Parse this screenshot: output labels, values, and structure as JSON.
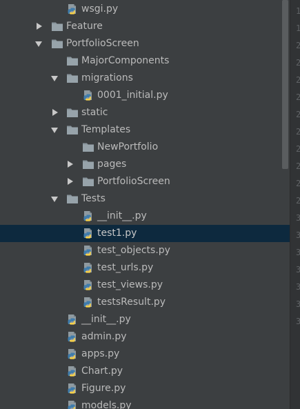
{
  "project_tree": {
    "selected_index": 13,
    "items": [
      {
        "label": "wsgi.py",
        "type": "python",
        "depth": 3,
        "arrow": "none"
      },
      {
        "label": "Feature",
        "type": "folder",
        "depth": 2,
        "arrow": "right"
      },
      {
        "label": "PortfolioScreen",
        "type": "folder",
        "depth": 2,
        "arrow": "down"
      },
      {
        "label": "MajorComponents",
        "type": "folder",
        "depth": 3,
        "arrow": "none"
      },
      {
        "label": "migrations",
        "type": "folder",
        "depth": 3,
        "arrow": "down"
      },
      {
        "label": "0001_initial.py",
        "type": "python",
        "depth": 4,
        "arrow": "none"
      },
      {
        "label": "static",
        "type": "folder",
        "depth": 3,
        "arrow": "right"
      },
      {
        "label": "Templates",
        "type": "folder",
        "depth": 3,
        "arrow": "down"
      },
      {
        "label": "NewPortfolio",
        "type": "folder",
        "depth": 4,
        "arrow": "none"
      },
      {
        "label": "pages",
        "type": "folder",
        "depth": 4,
        "arrow": "right"
      },
      {
        "label": "PortfolioScreen",
        "type": "folder",
        "depth": 4,
        "arrow": "right"
      },
      {
        "label": "Tests",
        "type": "folder",
        "depth": 3,
        "arrow": "down"
      },
      {
        "label": "__init__.py",
        "type": "python",
        "depth": 4,
        "arrow": "none"
      },
      {
        "label": "test1.py",
        "type": "python",
        "depth": 4,
        "arrow": "none"
      },
      {
        "label": "test_objects.py",
        "type": "python",
        "depth": 4,
        "arrow": "none"
      },
      {
        "label": "test_urls.py",
        "type": "python",
        "depth": 4,
        "arrow": "none"
      },
      {
        "label": "test_views.py",
        "type": "python",
        "depth": 4,
        "arrow": "none"
      },
      {
        "label": "testsResult.py",
        "type": "python",
        "depth": 4,
        "arrow": "none"
      },
      {
        "label": "__init__.py",
        "type": "python",
        "depth": 3,
        "arrow": "none"
      },
      {
        "label": "admin.py",
        "type": "python",
        "depth": 3,
        "arrow": "none"
      },
      {
        "label": "apps.py",
        "type": "python",
        "depth": 3,
        "arrow": "none"
      },
      {
        "label": "Chart.py",
        "type": "python",
        "depth": 3,
        "arrow": "none"
      },
      {
        "label": "Figure.py",
        "type": "python",
        "depth": 3,
        "arrow": "none"
      },
      {
        "label": "models.py",
        "type": "python",
        "depth": 3,
        "arrow": "none"
      }
    ]
  },
  "gutter": {
    "line_numbers": [
      "1",
      "1",
      "2",
      "2",
      "2",
      "2",
      "2",
      "2",
      "2",
      "2",
      "2",
      "2",
      "3",
      "3",
      "3",
      "3",
      "3",
      "3",
      "3"
    ]
  },
  "colors": {
    "background": "#3c3f41",
    "selection": "#0d293e",
    "text": "#bbbbbb",
    "folder": "#87939a",
    "python_blue": "#3f7cac",
    "python_yellow": "#f5d04c"
  }
}
